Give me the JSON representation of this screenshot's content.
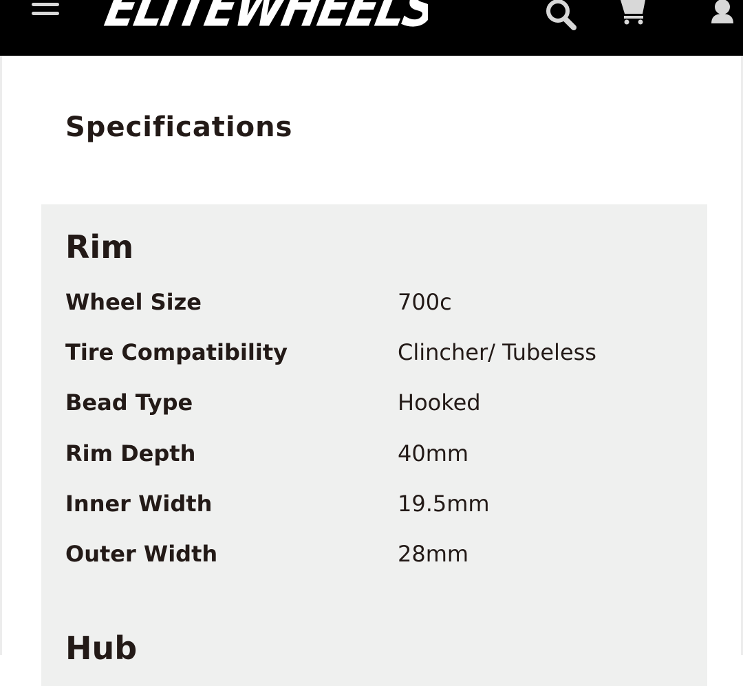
{
  "header": {
    "logo_text": "ELITEWHEELS",
    "menu_icon": "hamburger-menu-icon",
    "search_icon": "search-icon",
    "cart_icon": "shopping-cart-icon",
    "account_icon": "user-icon",
    "background_color": "#000000"
  },
  "specifications": {
    "heading": "Specifications",
    "sections": [
      {
        "title": "Rim",
        "rows": [
          {
            "label": "Wheel Size",
            "value": "700c"
          },
          {
            "label": "Tire Compatibility",
            "value": "Clincher/ Tubeless"
          },
          {
            "label": "Bead Type",
            "value": "Hooked"
          },
          {
            "label": "Rim Depth",
            "value": "40mm"
          },
          {
            "label": "Inner Width",
            "value": "19.5mm"
          },
          {
            "label": "Outer Width",
            "value": "28mm"
          }
        ]
      },
      {
        "title": "Hub"
      }
    ]
  },
  "colors": {
    "panel_background": "#eff0ef",
    "text": "#231a17"
  }
}
